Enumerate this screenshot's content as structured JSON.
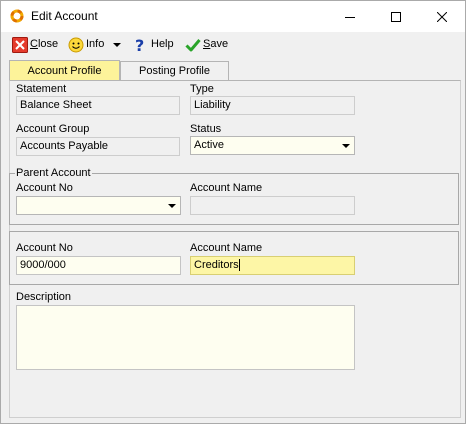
{
  "window": {
    "title": "Edit Account",
    "controls": {
      "minimize": "minimize",
      "maximize": "maximize",
      "close": "close"
    }
  },
  "toolbar": {
    "close_label": "Close",
    "info_label": "Info",
    "help_label": "Help",
    "save_label": "Save"
  },
  "tabs": [
    {
      "label": "Account Profile",
      "active": true
    },
    {
      "label": "Posting Profile",
      "active": false
    }
  ],
  "form": {
    "statement": {
      "label": "Statement",
      "value": "Balance Sheet"
    },
    "type": {
      "label": "Type",
      "value": "Liability"
    },
    "account_group": {
      "label": "Account Group",
      "value": "Accounts Payable"
    },
    "status": {
      "label": "Status",
      "value": "Active"
    },
    "parent_account": {
      "legend": "Parent Account",
      "account_no_label": "Account No",
      "account_no_value": "",
      "account_name_label": "Account Name",
      "account_name_value": ""
    },
    "account": {
      "account_no_label": "Account No",
      "account_no_value": "9000/000",
      "account_name_label": "Account Name",
      "account_name_value": "Creditors"
    },
    "description": {
      "label": "Description",
      "value": ""
    }
  },
  "colors": {
    "active_tab": "#fdf39a",
    "focused_field": "#fdf6a6",
    "editable_field": "#fefef0",
    "readonly_field": "#f0f0f0"
  }
}
